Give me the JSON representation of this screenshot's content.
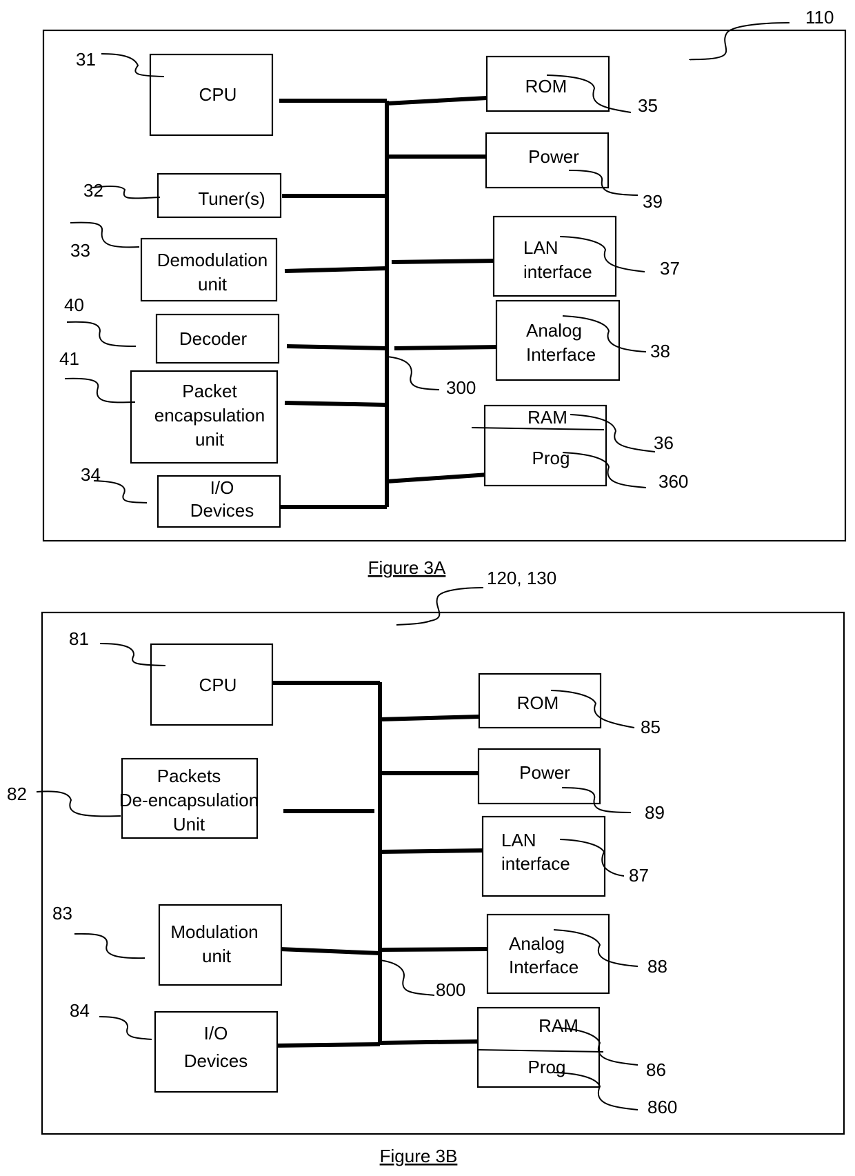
{
  "figure_a": {
    "caption": "Figure 3A",
    "device_ref": "110",
    "bus_ref": "300",
    "blocks": [
      {
        "id": "cpu",
        "lines": [
          "CPU"
        ],
        "ref": "31"
      },
      {
        "id": "tuner",
        "lines": [
          "Tuner(s)"
        ],
        "ref": "32"
      },
      {
        "id": "demod",
        "lines": [
          "Demodulation",
          "unit"
        ],
        "ref": "33"
      },
      {
        "id": "decoder",
        "lines": [
          "Decoder"
        ],
        "ref": "40"
      },
      {
        "id": "packet-encap",
        "lines": [
          "Packet",
          "encapsulation",
          "unit"
        ],
        "ref": "41"
      },
      {
        "id": "io",
        "lines": [
          "I/O",
          "Devices"
        ],
        "ref": "34"
      },
      {
        "id": "rom",
        "lines": [
          "ROM"
        ],
        "ref": "35"
      },
      {
        "id": "power",
        "lines": [
          "Power"
        ],
        "ref": "39"
      },
      {
        "id": "lan",
        "lines": [
          "LAN",
          "interface"
        ],
        "ref": "37"
      },
      {
        "id": "analog",
        "lines": [
          "Analog",
          "Interface"
        ],
        "ref": "38"
      },
      {
        "id": "ram",
        "lines": [
          "RAM"
        ],
        "ref": "36"
      },
      {
        "id": "prog",
        "lines": [
          "Prog"
        ],
        "ref": "360"
      }
    ]
  },
  "figure_b": {
    "caption": "Figure 3B",
    "device_ref": "120, 130",
    "bus_ref": "800",
    "blocks": [
      {
        "id": "cpu",
        "lines": [
          "CPU"
        ],
        "ref": "81"
      },
      {
        "id": "packet-decap",
        "lines": [
          "Packets",
          "De-encapsulation",
          "Unit"
        ],
        "ref": "82"
      },
      {
        "id": "mod",
        "lines": [
          "Modulation",
          "unit"
        ],
        "ref": "83"
      },
      {
        "id": "io",
        "lines": [
          "I/O",
          "Devices"
        ],
        "ref": "84"
      },
      {
        "id": "rom",
        "lines": [
          "ROM"
        ],
        "ref": "85"
      },
      {
        "id": "power",
        "lines": [
          "Power"
        ],
        "ref": "89"
      },
      {
        "id": "lan",
        "lines": [
          "LAN",
          "interface"
        ],
        "ref": "87"
      },
      {
        "id": "analog",
        "lines": [
          "Analog",
          "Interface"
        ],
        "ref": "88"
      },
      {
        "id": "ram",
        "lines": [
          "RAM"
        ],
        "ref": "86"
      },
      {
        "id": "prog",
        "lines": [
          "Prog"
        ],
        "ref": "860"
      }
    ]
  }
}
